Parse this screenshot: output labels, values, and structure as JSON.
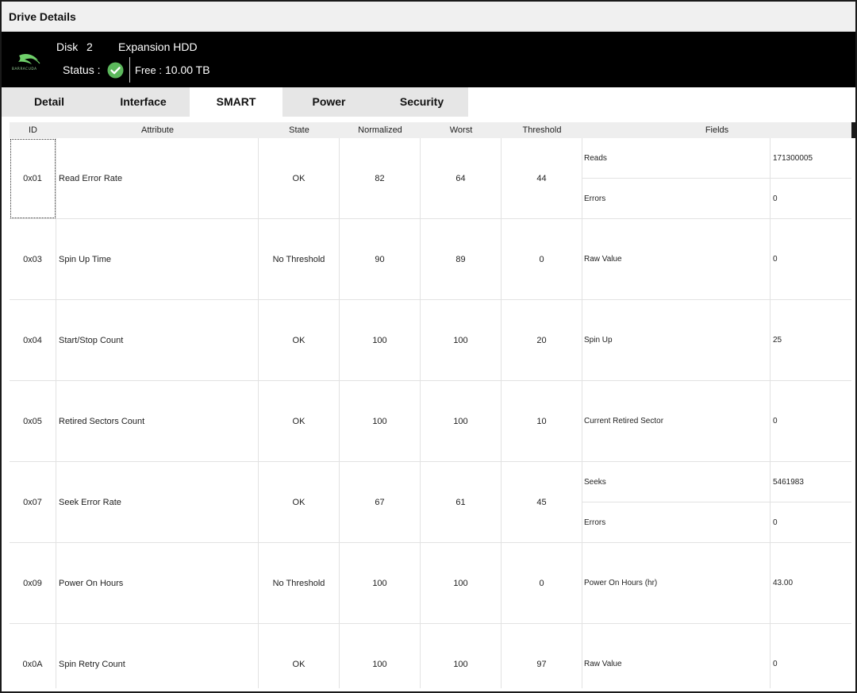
{
  "window": {
    "title": "Drive Details"
  },
  "header": {
    "disk_label": "Disk",
    "disk_number": "2",
    "model": "Expansion HDD",
    "status_label": "Status :",
    "status_icon": "check-circle-icon",
    "free_label": "Free :",
    "free_value": "10.00 TB",
    "logo_text": "BARRACUDA",
    "accent_color": "#5cb85c"
  },
  "tabs": [
    {
      "label": "Detail"
    },
    {
      "label": "Interface"
    },
    {
      "label": "SMART",
      "active": true
    },
    {
      "label": "Power"
    },
    {
      "label": "Security"
    }
  ],
  "table": {
    "columns": [
      "ID",
      "Attribute",
      "State",
      "Normalized",
      "Worst",
      "Threshold",
      "Fields"
    ],
    "rows": [
      {
        "id": "0x01",
        "attribute": "Read Error Rate",
        "state": "OK",
        "normalized": "82",
        "worst": "64",
        "threshold": "44",
        "fields": [
          {
            "name": "Reads",
            "value": "171300005"
          },
          {
            "name": "Errors",
            "value": "0"
          }
        ]
      },
      {
        "id": "0x03",
        "attribute": "Spin Up Time",
        "state": "No Threshold",
        "normalized": "90",
        "worst": "89",
        "threshold": "0",
        "fields": [
          {
            "name": "Raw Value",
            "value": "0"
          }
        ]
      },
      {
        "id": "0x04",
        "attribute": "Start/Stop Count",
        "state": "OK",
        "normalized": "100",
        "worst": "100",
        "threshold": "20",
        "fields": [
          {
            "name": "Spin Up",
            "value": "25"
          }
        ]
      },
      {
        "id": "0x05",
        "attribute": "Retired Sectors Count",
        "state": "OK",
        "normalized": "100",
        "worst": "100",
        "threshold": "10",
        "fields": [
          {
            "name": "Current Retired Sector",
            "value": "0"
          }
        ]
      },
      {
        "id": "0x07",
        "attribute": "Seek Error Rate",
        "state": "OK",
        "normalized": "67",
        "worst": "61",
        "threshold": "45",
        "fields": [
          {
            "name": "Seeks",
            "value": "5461983"
          },
          {
            "name": "Errors",
            "value": "0"
          }
        ]
      },
      {
        "id": "0x09",
        "attribute": "Power On Hours",
        "state": "No Threshold",
        "normalized": "100",
        "worst": "100",
        "threshold": "0",
        "fields": [
          {
            "name": "Power On Hours (hr)",
            "value": "43.00"
          }
        ]
      },
      {
        "id": "0x0A",
        "attribute": "Spin Retry Count",
        "state": "OK",
        "normalized": "100",
        "worst": "100",
        "threshold": "97",
        "fields": [
          {
            "name": "Raw Value",
            "value": "0"
          }
        ]
      }
    ]
  }
}
